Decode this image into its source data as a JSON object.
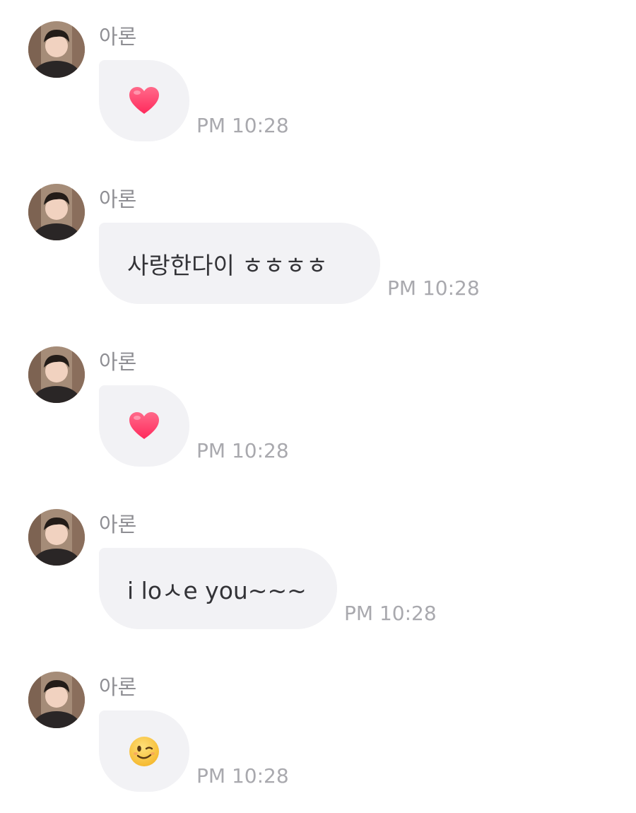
{
  "messages": [
    {
      "sender": "아론",
      "kind": "emoji",
      "emoji": "heart-emoji",
      "time": "PM 10:28"
    },
    {
      "sender": "아론",
      "kind": "text",
      "text": "사랑한다이 ㅎㅎㅎㅎ",
      "time": "PM 10:28"
    },
    {
      "sender": "아론",
      "kind": "emoji",
      "emoji": "heart-emoji",
      "time": "PM 10:28"
    },
    {
      "sender": "아론",
      "kind": "text",
      "text": "i loㅅe you~~~",
      "time": "PM 10:28"
    },
    {
      "sender": "아론",
      "kind": "emoji",
      "emoji": "winking-face-emoji",
      "time": "PM 10:28"
    }
  ],
  "colors": {
    "bubble": "#f2f2f5",
    "sender": "#8e8e93",
    "time": "#a9a9ae",
    "text": "#333337",
    "heart": "#ff3b6b",
    "wink": "#f7c634"
  }
}
